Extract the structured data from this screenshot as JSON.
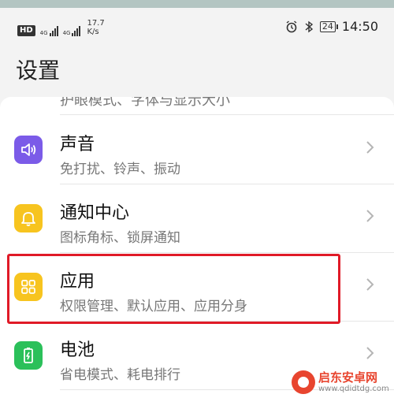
{
  "status_bar": {
    "hd_label": "HD",
    "signal1_label": "4G",
    "signal2_label": "4G",
    "speed_value": "17.7",
    "speed_unit": "K/s",
    "battery_level": "24",
    "time": "14:50",
    "icons": [
      "alarm-icon",
      "bluetooth-icon",
      "battery-icon"
    ]
  },
  "page": {
    "title": "设置",
    "partial_item_text": "护眼模式、字体与显示大小"
  },
  "settings_items": [
    {
      "title": "声音",
      "subtitle": "免打扰、铃声、振动",
      "icon": "sound-icon",
      "color": "#7b5be8"
    },
    {
      "title": "通知中心",
      "subtitle": "图标角标、锁屏通知",
      "icon": "notification-bell-icon",
      "color": "#f7c41f"
    },
    {
      "title": "应用",
      "subtitle": "权限管理、默认应用、应用分身",
      "icon": "apps-grid-icon",
      "color": "#f7c41f",
      "highlighted": true
    },
    {
      "title": "电池",
      "subtitle": "省电模式、耗电排行",
      "icon": "battery-charging-icon",
      "color": "#2bc05a"
    }
  ],
  "highlight_color": "#e01a27",
  "watermark": {
    "title": "启东安卓网",
    "url": "www.qdidtdg.com"
  }
}
